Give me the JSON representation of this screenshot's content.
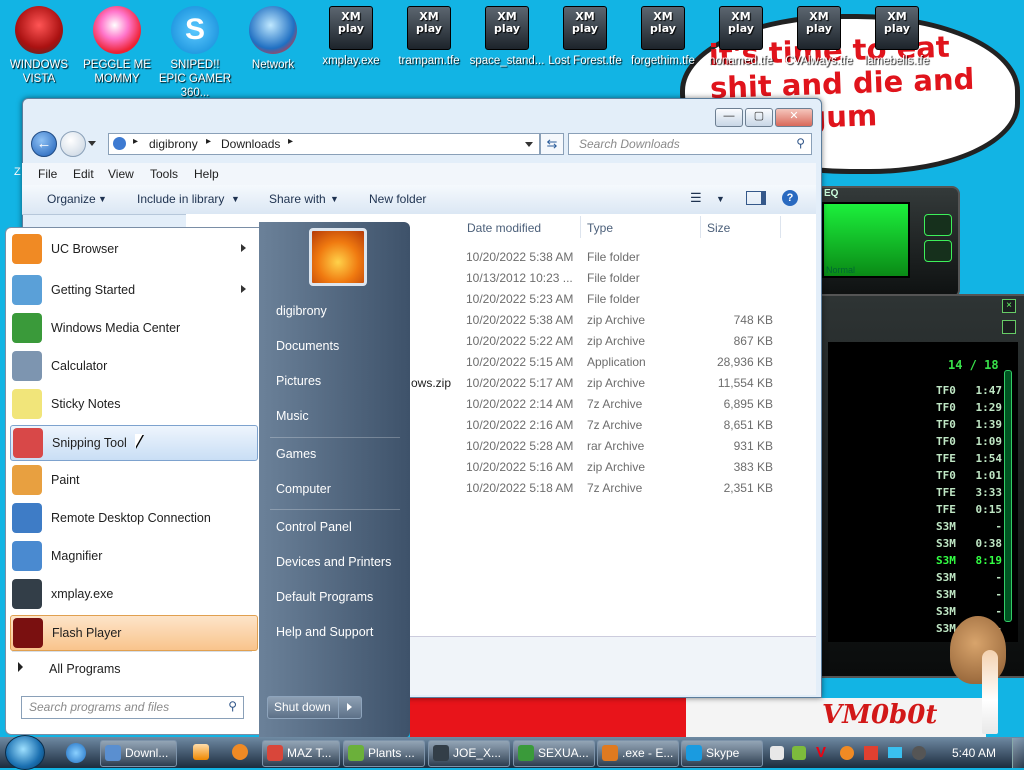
{
  "desktop": {
    "icons": [
      {
        "label": "WINDOWS VISTA",
        "icon": "vista-pod-icon"
      },
      {
        "label": "PEGGLE ME MOMMY",
        "icon": "peggle-icon"
      },
      {
        "label": "SNIPED!! EPIC GAMER 360...",
        "icon": "skype-icon"
      },
      {
        "label": "Network",
        "icon": "network-icon"
      },
      {
        "label": "xmplay.exe",
        "icon": "xmplay-icon"
      },
      {
        "label": "trampam.tfe",
        "icon": "xmplay-icon"
      },
      {
        "label": "space_stand...",
        "icon": "xmplay-icon"
      },
      {
        "label": "Lost Forest.tfe",
        "icon": "xmplay-icon"
      },
      {
        "label": "forgethim.tfe",
        "icon": "xmplay-icon"
      },
      {
        "label": "nonamed.tfe",
        "icon": "xmplay-icon"
      },
      {
        "label": "CVAlways.tfe",
        "icon": "xmplay-icon"
      },
      {
        "label": "lamebells.tfe",
        "icon": "xmplay-icon"
      }
    ],
    "xm_top": "XM",
    "xm_bottom": "play",
    "bubble_text": "it's time to eat shit and die and chew gum",
    "signature": "VM0b0t",
    "partial_left_char": "Z"
  },
  "player": {
    "eq_label": "EQ",
    "lcd_text": "Normal",
    "track_counter": "14 / 18",
    "tracks": [
      {
        "type": "TF0",
        "time": "1:47"
      },
      {
        "type": "TF0",
        "time": "1:29"
      },
      {
        "type": "TF0",
        "time": "1:39"
      },
      {
        "type": "TF0",
        "time": "1:09"
      },
      {
        "type": "TFE",
        "time": "1:54"
      },
      {
        "type": "TF0",
        "time": "1:01"
      },
      {
        "type": "TFE",
        "time": "3:33"
      },
      {
        "type": "TFE",
        "time": "0:15"
      },
      {
        "type": "S3M",
        "time": "-"
      },
      {
        "type": "S3M",
        "time": "0:38"
      },
      {
        "type": "S3M",
        "time": "8:19",
        "active": true
      },
      {
        "type": "S3M",
        "time": "-"
      },
      {
        "type": "S3M",
        "time": "-"
      },
      {
        "type": "S3M",
        "time": "-"
      },
      {
        "type": "S3M",
        "time": "-"
      }
    ]
  },
  "explorer": {
    "breadcrumb": [
      "digibrony",
      "Downloads"
    ],
    "search_placeholder": "Search Downloads",
    "menu": [
      "File",
      "Edit",
      "View",
      "Tools",
      "Help"
    ],
    "commands": [
      "Organize",
      "Include in library",
      "Share with",
      "New folder"
    ],
    "columns": [
      "Date modified",
      "Type",
      "Size"
    ],
    "partial_name": "ows.zip",
    "rows": [
      {
        "date": "10/20/2022 5:38 AM",
        "type": "File folder",
        "size": ""
      },
      {
        "date": "10/13/2012 10:23 ...",
        "type": "File folder",
        "size": ""
      },
      {
        "date": "10/20/2022 5:23 AM",
        "type": "File folder",
        "size": ""
      },
      {
        "date": "10/20/2022 5:38 AM",
        "type": "zip Archive",
        "size": "748 KB"
      },
      {
        "date": "10/20/2022 5:22 AM",
        "type": "zip Archive",
        "size": "867 KB"
      },
      {
        "date": "10/20/2022 5:15 AM",
        "type": "Application",
        "size": "28,936 KB"
      },
      {
        "date": "10/20/2022 5:17 AM",
        "type": "zip Archive",
        "size": "11,554 KB"
      },
      {
        "date": "10/20/2022 2:14 AM",
        "type": "7z Archive",
        "size": "6,895 KB"
      },
      {
        "date": "10/20/2022 2:16 AM",
        "type": "7z Archive",
        "size": "8,651 KB"
      },
      {
        "date": "10/20/2022 5:28 AM",
        "type": "rar Archive",
        "size": "931 KB"
      },
      {
        "date": "10/20/2022 5:16 AM",
        "type": "zip Archive",
        "size": "383 KB"
      },
      {
        "date": "10/20/2022 5:18 AM",
        "type": "7z Archive",
        "size": "2,351 KB"
      }
    ]
  },
  "start_menu": {
    "programs": [
      {
        "label": "UC Browser",
        "icon": "uc-browser-icon",
        "submenu": true,
        "color": "#f08a24"
      },
      {
        "label": "Getting Started",
        "icon": "getting-started-icon",
        "submenu": true,
        "color": "#5aa0d8"
      },
      {
        "label": "Windows Media Center",
        "icon": "media-center-icon",
        "submenu": false,
        "color": "#3a9a3a"
      },
      {
        "label": "Calculator",
        "icon": "calculator-icon",
        "submenu": false,
        "color": "#7d95b0"
      },
      {
        "label": "Sticky Notes",
        "icon": "sticky-notes-icon",
        "submenu": false,
        "color": "#f1e57a"
      },
      {
        "label": "Snipping Tool",
        "icon": "snipping-tool-icon",
        "submenu": false,
        "color": "#d84848"
      },
      {
        "label": "Paint",
        "icon": "paint-icon",
        "submenu": false,
        "color": "#e8a040"
      },
      {
        "label": "Remote Desktop Connection",
        "icon": "remote-desktop-icon",
        "submenu": false,
        "color": "#3e7cc6"
      },
      {
        "label": "Magnifier",
        "icon": "magnifier-icon",
        "submenu": false,
        "color": "#4a8ad0"
      },
      {
        "label": "xmplay.exe",
        "icon": "xmplay-icon",
        "submenu": false,
        "color": "#333e48"
      },
      {
        "label": "Flash Player",
        "icon": "flash-player-icon",
        "submenu": false,
        "color": "#7a1010"
      }
    ],
    "all_programs": "All Programs",
    "search_placeholder": "Search programs and files",
    "shutdown": "Shut down",
    "user": "digibrony",
    "links_group1": [
      "Documents",
      "Pictures",
      "Music"
    ],
    "links_group2": [
      "Games",
      "Computer"
    ],
    "links_group3": [
      "Control Panel",
      "Devices and Printers",
      "Default Programs",
      "Help and Support"
    ]
  },
  "taskbar": {
    "buttons": [
      {
        "label": "Downl...",
        "icon": "explorer-icon",
        "color": "#5a8fd0"
      },
      {
        "label": "MAZ T...",
        "icon": "chrome-icon",
        "color": "#d9463a"
      },
      {
        "label": "Plants ...",
        "icon": "plants-icon",
        "color": "#6bb03a"
      },
      {
        "label": "JOE_X...",
        "icon": "xmplay-icon",
        "color": "#333e48"
      },
      {
        "label": "SEXUA...",
        "icon": "cheat-engine-icon",
        "color": "#3a9a3a"
      },
      {
        "label": ".exe - E...",
        "icon": "search-tool-icon",
        "color": "#e07a20"
      },
      {
        "label": "Skype",
        "icon": "skype-icon",
        "color": "#1a9be0"
      }
    ],
    "clock": "5:40 AM",
    "colors": {
      "taskbar_top": "#6f8aa3",
      "desktop": "#12b4e4"
    }
  }
}
